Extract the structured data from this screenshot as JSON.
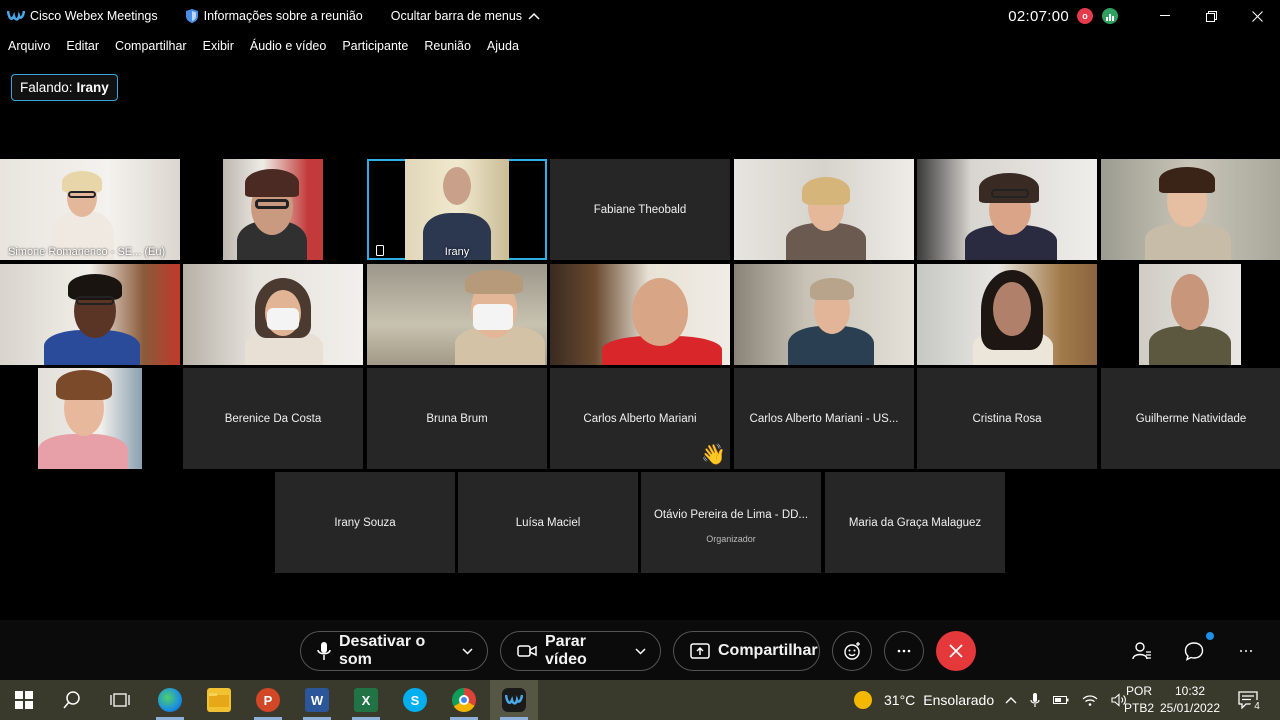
{
  "titlebar": {
    "app_name": "Cisco Webex Meetings",
    "meeting_info": "Informações sobre a reunião",
    "hide_menu": "Ocultar barra de menus",
    "timer": "02:07:00",
    "rec_letter": "o"
  },
  "menu": [
    "Arquivo",
    "Editar",
    "Compartilhar",
    "Exibir",
    "Áudio e vídeo",
    "Participante",
    "Reunião",
    "Ajuda"
  ],
  "speaking": {
    "label": "Falando:",
    "name": "Irany"
  },
  "participants": {
    "simone": "Simone Romanenco - SE...",
    "simone_suffix": "(Eu)",
    "irany_video": "Irany",
    "fabiane": "Fabiane Theobald",
    "berenice": "Berenice Da Costa",
    "bruna": "Bruna Brum",
    "carlos1": "Carlos Alberto Mariani",
    "carlos2": "Carlos Alberto Mariani - US...",
    "cristina": "Cristina Rosa",
    "guilherme": "Guilherme Natividade",
    "irany_souza": "Irany Souza",
    "luisa": "Luísa Maciel",
    "otavio": "Otávio Pereira de Lima - DD...",
    "otavio_role": "Organizador",
    "maria": "Maria da Graça Malaguez"
  },
  "toolbar": {
    "mute_label": "Desativar o som",
    "video_label": "Parar vídeo",
    "share_label": "Compartilhar"
  },
  "taskbar": {
    "temperature": "31°C",
    "weather": "Ensolarado",
    "lang_top": "POR",
    "lang_bottom": "PTB2",
    "time": "10:32",
    "date": "25/01/2022",
    "notifications": "4"
  },
  "colors": {
    "accent": "#30aee8",
    "end_call": "#e5383b",
    "tile_bg": "#262626",
    "taskbar_bg": "#3a3a2c"
  }
}
